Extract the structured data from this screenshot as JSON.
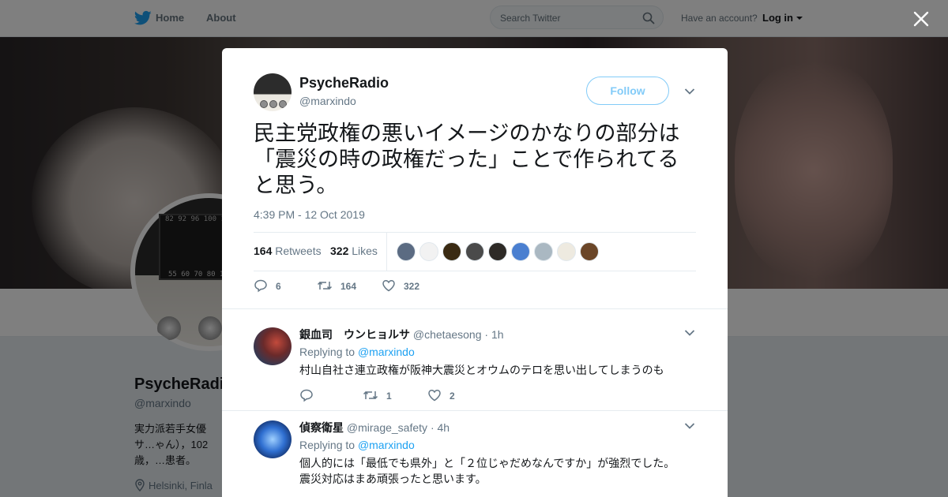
{
  "topbar": {
    "home_label": "Home",
    "about_label": "About",
    "search_placeholder": "Search Twitter",
    "account_prompt": "Have an account?",
    "login_label": "Log in"
  },
  "profile_background": {
    "name": "PsycheRadio",
    "handle": "@marxindo",
    "bio": "実力派若手女優サ…ゃん），102歳，…患者。",
    "location": "Helsinki, Finla"
  },
  "modal": {
    "author": {
      "name": "PsycheRadio",
      "handle": "@marxindo"
    },
    "follow_label": "Follow",
    "tweet_text": "民主党政権の悪いイメージのかなりの部分は「震災の時の政権だった」ことで作られてると思う。",
    "timestamp": "4:39 PM - 12 Oct 2019",
    "stats": {
      "retweets_count": "164",
      "retweets_label": "Retweets",
      "likes_count": "322",
      "likes_label": "Likes"
    },
    "liker_colors": [
      "#5b6b82",
      "#f2f2f2",
      "#3a2a12",
      "#4a4a4a",
      "#2e2a26",
      "#4a7fd0",
      "#aab8c2",
      "#eeeae0",
      "#6b4628"
    ],
    "actions": {
      "replies": "6",
      "retweets": "164",
      "likes": "322"
    }
  },
  "replies": [
    {
      "name": "銀血司　ウンヒョルサ",
      "handle": "@chetaesong",
      "time": "1h",
      "replying_prefix": "Replying to",
      "replying_to": "@marxindo",
      "text": "村山自社さ連立政権が阪神大震災とオウムのテロを思い出してしまうのも",
      "replies": "",
      "retweets": "1",
      "likes": "2"
    },
    {
      "name": "偵察衛星",
      "handle": "@mirage_safety",
      "time": "4h",
      "replying_prefix": "Replying to",
      "replying_to": "@marxindo",
      "text": "個人的には「最低でも県外」と「２位じゃだめなんですか」が強烈でした。\n震災対応はまあ頑張ったと思います。"
    }
  ]
}
